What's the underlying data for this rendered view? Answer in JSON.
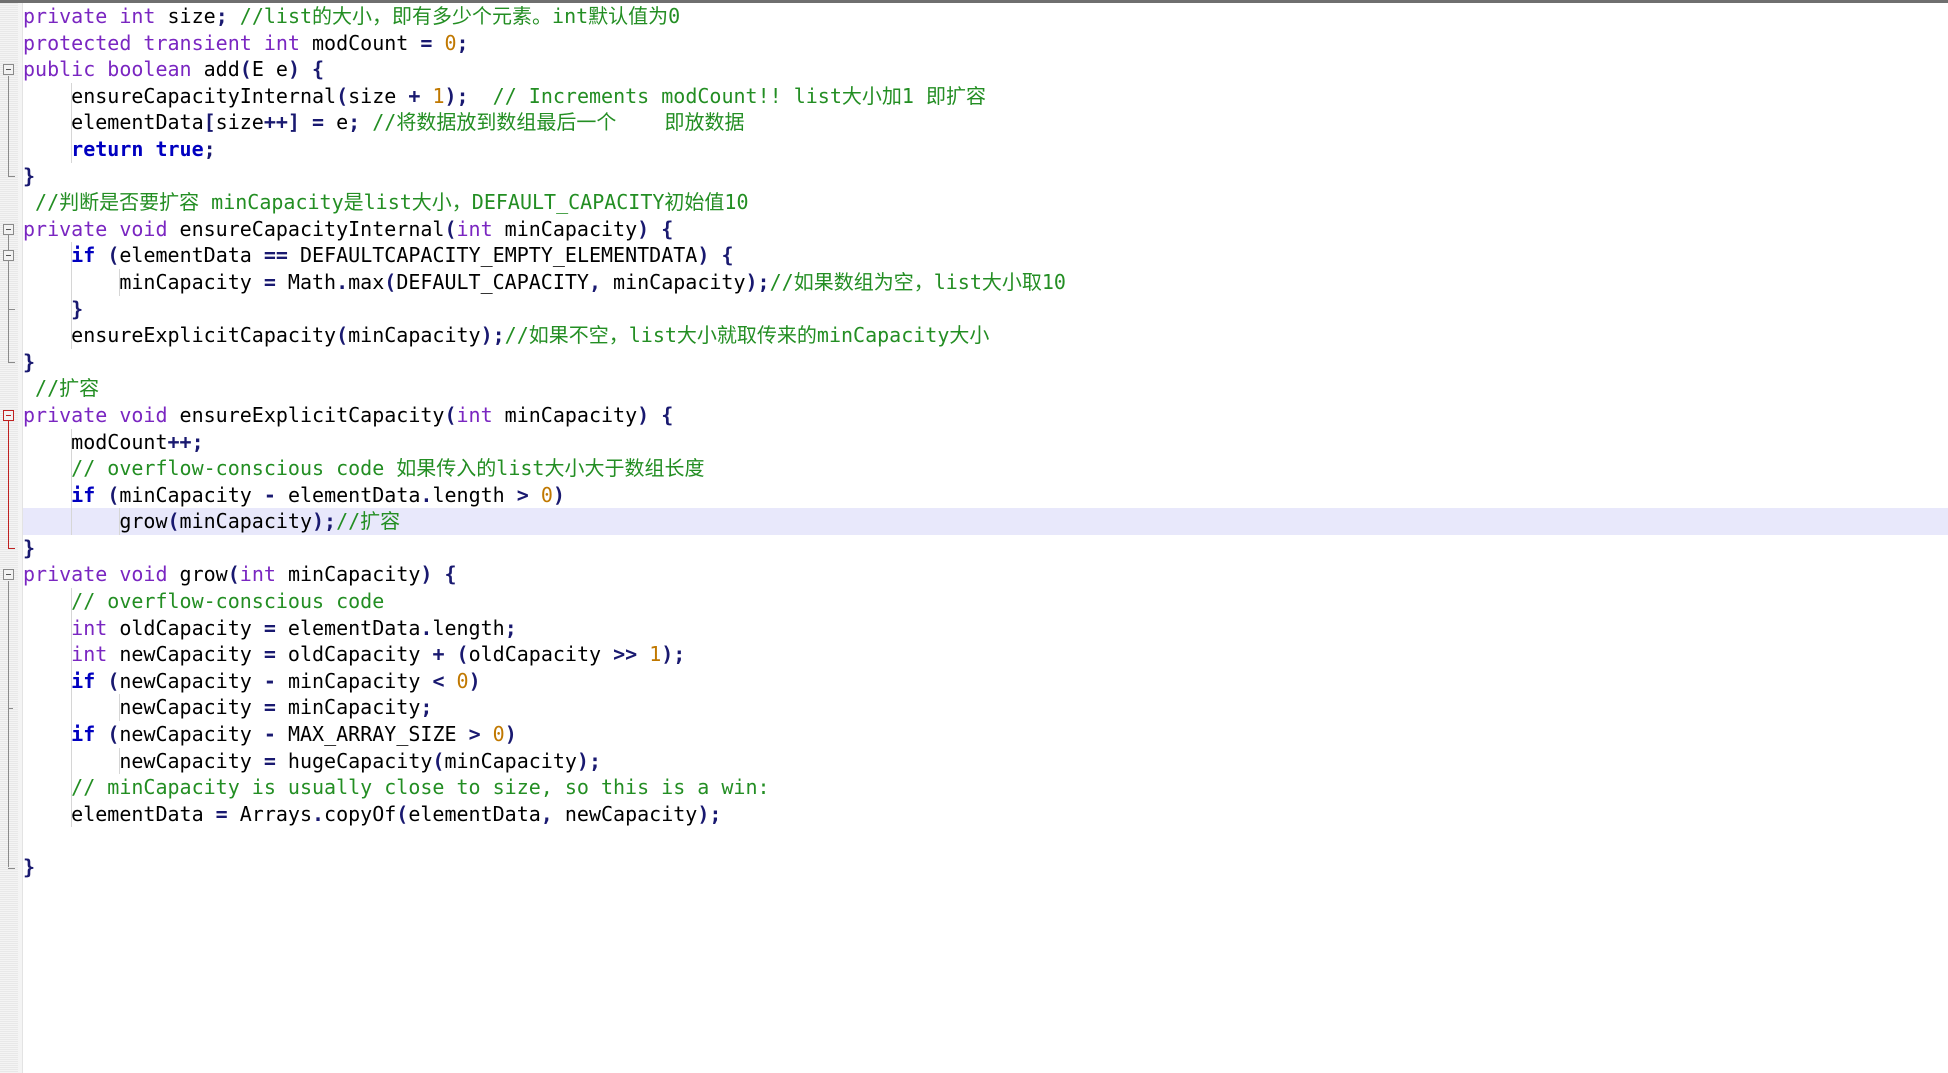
{
  "editor": {
    "language": "java",
    "kind": "source-code-editor",
    "colors": {
      "background": "#ffffff",
      "gutter": "#e8e8e8",
      "current_line_highlight": "#e8e8fb",
      "keyword": "#7a26c1",
      "keyword_bold": "#0000c0",
      "comment": "#238e23",
      "number": "#c07800",
      "punctuation": "#191970",
      "identifier": "#000000",
      "fold_marker": "#8a8a8a",
      "fold_marker_active": "#c02020"
    },
    "current_line_number": 20
  },
  "code": {
    "lines": [
      {
        "n": 1,
        "indent": 1,
        "fold": null,
        "guides": [],
        "tokens": [
          {
            "t": "private",
            "c": "kw"
          },
          {
            "t": " ",
            "c": "id"
          },
          {
            "t": "int",
            "c": "kw"
          },
          {
            "t": " size",
            "c": "id"
          },
          {
            "t": ";",
            "c": "pn"
          },
          {
            "t": " ",
            "c": "id"
          },
          {
            "t": "//list的大小，即有多少个元素。int默认值为0",
            "c": "cm"
          }
        ]
      },
      {
        "n": 2,
        "indent": 1,
        "fold": null,
        "guides": [],
        "tokens": [
          {
            "t": "protected",
            "c": "kw"
          },
          {
            "t": " ",
            "c": "id"
          },
          {
            "t": "transient",
            "c": "kw"
          },
          {
            "t": " ",
            "c": "id"
          },
          {
            "t": "int",
            "c": "kw"
          },
          {
            "t": " modCount ",
            "c": "id"
          },
          {
            "t": "=",
            "c": "pn"
          },
          {
            "t": " ",
            "c": "id"
          },
          {
            "t": "0",
            "c": "num"
          },
          {
            "t": ";",
            "c": "pn"
          }
        ]
      },
      {
        "n": 3,
        "indent": 0,
        "fold": "open",
        "guides": [],
        "tokens": [
          {
            "t": "public",
            "c": "kw"
          },
          {
            "t": " ",
            "c": "id"
          },
          {
            "t": "boolean",
            "c": "kw"
          },
          {
            "t": " add",
            "c": "id"
          },
          {
            "t": "(",
            "c": "pn"
          },
          {
            "t": "E e",
            "c": "id"
          },
          {
            "t": ") {",
            "c": "pn"
          }
        ]
      },
      {
        "n": 4,
        "indent": 1,
        "fold": null,
        "guides": [
          1
        ],
        "tokens": [
          {
            "t": "    ensureCapacityInternal",
            "c": "id"
          },
          {
            "t": "(",
            "c": "pn"
          },
          {
            "t": "size ",
            "c": "id"
          },
          {
            "t": "+",
            "c": "pn"
          },
          {
            "t": " ",
            "c": "id"
          },
          {
            "t": "1",
            "c": "num"
          },
          {
            "t": ");",
            "c": "pn"
          },
          {
            "t": "  ",
            "c": "id"
          },
          {
            "t": "// Increments modCount!! list大小加1 即扩容",
            "c": "cm"
          }
        ]
      },
      {
        "n": 5,
        "indent": 1,
        "fold": null,
        "guides": [
          1
        ],
        "tokens": [
          {
            "t": "    elementData",
            "c": "id"
          },
          {
            "t": "[",
            "c": "pn"
          },
          {
            "t": "size",
            "c": "id"
          },
          {
            "t": "++]",
            "c": "pn"
          },
          {
            "t": " ",
            "c": "id"
          },
          {
            "t": "=",
            "c": "pn"
          },
          {
            "t": " e",
            "c": "id"
          },
          {
            "t": ";",
            "c": "pn"
          },
          {
            "t": " ",
            "c": "id"
          },
          {
            "t": "//将数据放到数组最后一个    即放数据",
            "c": "cm"
          }
        ]
      },
      {
        "n": 6,
        "indent": 1,
        "fold": null,
        "guides": [
          1
        ],
        "tokens": [
          {
            "t": "    ",
            "c": "id"
          },
          {
            "t": "return",
            "c": "kwb"
          },
          {
            "t": " ",
            "c": "id"
          },
          {
            "t": "true",
            "c": "kwb"
          },
          {
            "t": ";",
            "c": "pn"
          }
        ]
      },
      {
        "n": 7,
        "indent": 0,
        "fold": "end",
        "guides": [],
        "tokens": [
          {
            "t": "}",
            "c": "brace"
          }
        ]
      },
      {
        "n": 8,
        "indent": 1,
        "fold": null,
        "guides": [],
        "tokens": [
          {
            "t": " //判断是否要扩容 minCapacity是list大小，DEFAULT_CAPACITY初始值10",
            "c": "cm"
          }
        ]
      },
      {
        "n": 9,
        "indent": 0,
        "fold": "open",
        "guides": [],
        "tokens": [
          {
            "t": "private",
            "c": "kw"
          },
          {
            "t": " ",
            "c": "id"
          },
          {
            "t": "void",
            "c": "kw"
          },
          {
            "t": " ensureCapacityInternal",
            "c": "id"
          },
          {
            "t": "(",
            "c": "pn"
          },
          {
            "t": "int",
            "c": "kw"
          },
          {
            "t": " minCapacity",
            "c": "id"
          },
          {
            "t": ") {",
            "c": "pn"
          }
        ]
      },
      {
        "n": 10,
        "indent": 1,
        "fold": "open-inner",
        "guides": [
          1
        ],
        "tokens": [
          {
            "t": "    ",
            "c": "id"
          },
          {
            "t": "if",
            "c": "kwb"
          },
          {
            "t": " ",
            "c": "id"
          },
          {
            "t": "(",
            "c": "pn"
          },
          {
            "t": "elementData ",
            "c": "id"
          },
          {
            "t": "==",
            "c": "pn"
          },
          {
            "t": " DEFAULTCAPACITY_EMPTY_ELEMENTDATA",
            "c": "id"
          },
          {
            "t": ") {",
            "c": "pn"
          }
        ]
      },
      {
        "n": 11,
        "indent": 2,
        "fold": null,
        "guides": [
          1,
          2
        ],
        "tokens": [
          {
            "t": "        minCapacity ",
            "c": "id"
          },
          {
            "t": "=",
            "c": "pn"
          },
          {
            "t": " Math",
            "c": "id"
          },
          {
            "t": ".",
            "c": "pn"
          },
          {
            "t": "max",
            "c": "id"
          },
          {
            "t": "(",
            "c": "pn"
          },
          {
            "t": "DEFAULT_CAPACITY",
            "c": "id"
          },
          {
            "t": ",",
            "c": "pn"
          },
          {
            "t": " minCapacity",
            "c": "id"
          },
          {
            "t": ");",
            "c": "pn"
          },
          {
            "t": "//如果数组为空，list大小取10",
            "c": "cm"
          }
        ]
      },
      {
        "n": 12,
        "indent": 1,
        "fold": "end-inner",
        "guides": [
          1
        ],
        "tokens": [
          {
            "t": "    ",
            "c": "id"
          },
          {
            "t": "}",
            "c": "brace"
          }
        ]
      },
      {
        "n": 13,
        "indent": 1,
        "fold": null,
        "guides": [
          1
        ],
        "tokens": [
          {
            "t": "    ensureExplicitCapacity",
            "c": "id"
          },
          {
            "t": "(",
            "c": "pn"
          },
          {
            "t": "minCapacity",
            "c": "id"
          },
          {
            "t": ");",
            "c": "pn"
          },
          {
            "t": "//如果不空，list大小就取传来的minCapacity大小",
            "c": "cm"
          }
        ]
      },
      {
        "n": 14,
        "indent": 0,
        "fold": "end",
        "guides": [],
        "tokens": [
          {
            "t": "}",
            "c": "brace"
          }
        ]
      },
      {
        "n": 15,
        "indent": 1,
        "fold": null,
        "guides": [],
        "tokens": [
          {
            "t": " //扩容",
            "c": "cm"
          }
        ]
      },
      {
        "n": 16,
        "indent": 0,
        "fold": "open-active",
        "guides": [],
        "tokens": [
          {
            "t": "private",
            "c": "kw"
          },
          {
            "t": " ",
            "c": "id"
          },
          {
            "t": "void",
            "c": "kw"
          },
          {
            "t": " ensureExplicitCapacity",
            "c": "id"
          },
          {
            "t": "(",
            "c": "pn"
          },
          {
            "t": "int",
            "c": "kw"
          },
          {
            "t": " minCapacity",
            "c": "id"
          },
          {
            "t": ") {",
            "c": "pn"
          }
        ]
      },
      {
        "n": 17,
        "indent": 1,
        "fold": null,
        "guides": [
          1
        ],
        "tokens": [
          {
            "t": "    modCount",
            "c": "id"
          },
          {
            "t": "++;",
            "c": "pn"
          }
        ]
      },
      {
        "n": 18,
        "indent": 1,
        "fold": null,
        "guides": [
          1
        ],
        "tokens": [
          {
            "t": "    ",
            "c": "id"
          },
          {
            "t": "// overflow-conscious code 如果传入的list大小大于数组长度",
            "c": "cm"
          }
        ]
      },
      {
        "n": 19,
        "indent": 1,
        "fold": null,
        "guides": [
          1
        ],
        "tokens": [
          {
            "t": "    ",
            "c": "id"
          },
          {
            "t": "if",
            "c": "kwb"
          },
          {
            "t": " ",
            "c": "id"
          },
          {
            "t": "(",
            "c": "pn"
          },
          {
            "t": "minCapacity ",
            "c": "id"
          },
          {
            "t": "-",
            "c": "pn"
          },
          {
            "t": " elementData",
            "c": "id"
          },
          {
            "t": ".",
            "c": "pn"
          },
          {
            "t": "length ",
            "c": "id"
          },
          {
            "t": ">",
            "c": "pn"
          },
          {
            "t": " ",
            "c": "id"
          },
          {
            "t": "0",
            "c": "num"
          },
          {
            "t": ")",
            "c": "pn"
          }
        ]
      },
      {
        "n": 20,
        "indent": 2,
        "fold": null,
        "guides": [
          1,
          2
        ],
        "current": true,
        "tokens": [
          {
            "t": "        grow",
            "c": "id"
          },
          {
            "t": "(",
            "c": "pn"
          },
          {
            "t": "minCapacity",
            "c": "id"
          },
          {
            "t": ");",
            "c": "pn"
          },
          {
            "t": "//扩容",
            "c": "cm"
          }
        ]
      },
      {
        "n": 21,
        "indent": 0,
        "fold": "end-active",
        "guides": [],
        "tokens": [
          {
            "t": "}",
            "c": "brace"
          }
        ]
      },
      {
        "n": 22,
        "indent": 0,
        "fold": "open",
        "guides": [],
        "tokens": [
          {
            "t": "private",
            "c": "kw"
          },
          {
            "t": " ",
            "c": "id"
          },
          {
            "t": "void",
            "c": "kw"
          },
          {
            "t": " grow",
            "c": "id"
          },
          {
            "t": "(",
            "c": "pn"
          },
          {
            "t": "int",
            "c": "kw"
          },
          {
            "t": " minCapacity",
            "c": "id"
          },
          {
            "t": ") {",
            "c": "pn"
          }
        ]
      },
      {
        "n": 23,
        "indent": 1,
        "fold": null,
        "guides": [
          1
        ],
        "tokens": [
          {
            "t": "    ",
            "c": "id"
          },
          {
            "t": "// overflow-conscious code",
            "c": "cm"
          }
        ]
      },
      {
        "n": 24,
        "indent": 1,
        "fold": null,
        "guides": [
          1
        ],
        "tokens": [
          {
            "t": "    ",
            "c": "id"
          },
          {
            "t": "int",
            "c": "kw"
          },
          {
            "t": " oldCapacity ",
            "c": "id"
          },
          {
            "t": "=",
            "c": "pn"
          },
          {
            "t": " elementData",
            "c": "id"
          },
          {
            "t": ".",
            "c": "pn"
          },
          {
            "t": "length",
            "c": "id"
          },
          {
            "t": ";",
            "c": "pn"
          }
        ]
      },
      {
        "n": 25,
        "indent": 1,
        "fold": null,
        "guides": [
          1
        ],
        "tokens": [
          {
            "t": "    ",
            "c": "id"
          },
          {
            "t": "int",
            "c": "kw"
          },
          {
            "t": " newCapacity ",
            "c": "id"
          },
          {
            "t": "=",
            "c": "pn"
          },
          {
            "t": " oldCapacity ",
            "c": "id"
          },
          {
            "t": "+",
            "c": "pn"
          },
          {
            "t": " ",
            "c": "id"
          },
          {
            "t": "(",
            "c": "pn"
          },
          {
            "t": "oldCapacity ",
            "c": "id"
          },
          {
            "t": ">>",
            "c": "pn"
          },
          {
            "t": " ",
            "c": "id"
          },
          {
            "t": "1",
            "c": "num"
          },
          {
            "t": ");",
            "c": "pn"
          }
        ]
      },
      {
        "n": 26,
        "indent": 1,
        "fold": null,
        "guides": [
          1
        ],
        "tokens": [
          {
            "t": "    ",
            "c": "id"
          },
          {
            "t": "if",
            "c": "kwb"
          },
          {
            "t": " ",
            "c": "id"
          },
          {
            "t": "(",
            "c": "pn"
          },
          {
            "t": "newCapacity ",
            "c": "id"
          },
          {
            "t": "-",
            "c": "pn"
          },
          {
            "t": " minCapacity ",
            "c": "id"
          },
          {
            "t": "<",
            "c": "pn"
          },
          {
            "t": " ",
            "c": "id"
          },
          {
            "t": "0",
            "c": "num"
          },
          {
            "t": ")",
            "c": "pn"
          }
        ]
      },
      {
        "n": 27,
        "indent": 2,
        "fold": null,
        "guides": [
          1,
          2
        ],
        "tokens": [
          {
            "t": "        newCapacity ",
            "c": "id"
          },
          {
            "t": "=",
            "c": "pn"
          },
          {
            "t": " minCapacity",
            "c": "id"
          },
          {
            "t": ";",
            "c": "pn"
          }
        ]
      },
      {
        "n": 28,
        "indent": 1,
        "fold": null,
        "guides": [
          1
        ],
        "tokens": [
          {
            "t": "    ",
            "c": "id"
          },
          {
            "t": "if",
            "c": "kwb"
          },
          {
            "t": " ",
            "c": "id"
          },
          {
            "t": "(",
            "c": "pn"
          },
          {
            "t": "newCapacity ",
            "c": "id"
          },
          {
            "t": "-",
            "c": "pn"
          },
          {
            "t": " MAX_ARRAY_SIZE ",
            "c": "id"
          },
          {
            "t": ">",
            "c": "pn"
          },
          {
            "t": " ",
            "c": "id"
          },
          {
            "t": "0",
            "c": "num"
          },
          {
            "t": ")",
            "c": "pn"
          }
        ]
      },
      {
        "n": 29,
        "indent": 2,
        "fold": null,
        "guides": [
          1,
          2
        ],
        "tokens": [
          {
            "t": "        newCapacity ",
            "c": "id"
          },
          {
            "t": "=",
            "c": "pn"
          },
          {
            "t": " hugeCapacity",
            "c": "id"
          },
          {
            "t": "(",
            "c": "pn"
          },
          {
            "t": "minCapacity",
            "c": "id"
          },
          {
            "t": ");",
            "c": "pn"
          }
        ]
      },
      {
        "n": 30,
        "indent": 1,
        "fold": null,
        "guides": [
          1
        ],
        "tokens": [
          {
            "t": "    ",
            "c": "id"
          },
          {
            "t": "// minCapacity is usually close to size, so this is a win:",
            "c": "cm"
          }
        ]
      },
      {
        "n": 31,
        "indent": 1,
        "fold": null,
        "guides": [
          1
        ],
        "tokens": [
          {
            "t": "    elementData ",
            "c": "id"
          },
          {
            "t": "=",
            "c": "pn"
          },
          {
            "t": " Arrays",
            "c": "id"
          },
          {
            "t": ".",
            "c": "pn"
          },
          {
            "t": "copyOf",
            "c": "id"
          },
          {
            "t": "(",
            "c": "pn"
          },
          {
            "t": "elementData",
            "c": "id"
          },
          {
            "t": ",",
            "c": "pn"
          },
          {
            "t": " newCapacity",
            "c": "id"
          },
          {
            "t": ");",
            "c": "pn"
          }
        ]
      },
      {
        "n": 32,
        "indent": 0,
        "fold": null,
        "guides": [],
        "tokens": []
      },
      {
        "n": 33,
        "indent": 0,
        "fold": "end",
        "guides": [],
        "tokens": [
          {
            "t": "}",
            "c": "brace"
          }
        ]
      }
    ]
  }
}
